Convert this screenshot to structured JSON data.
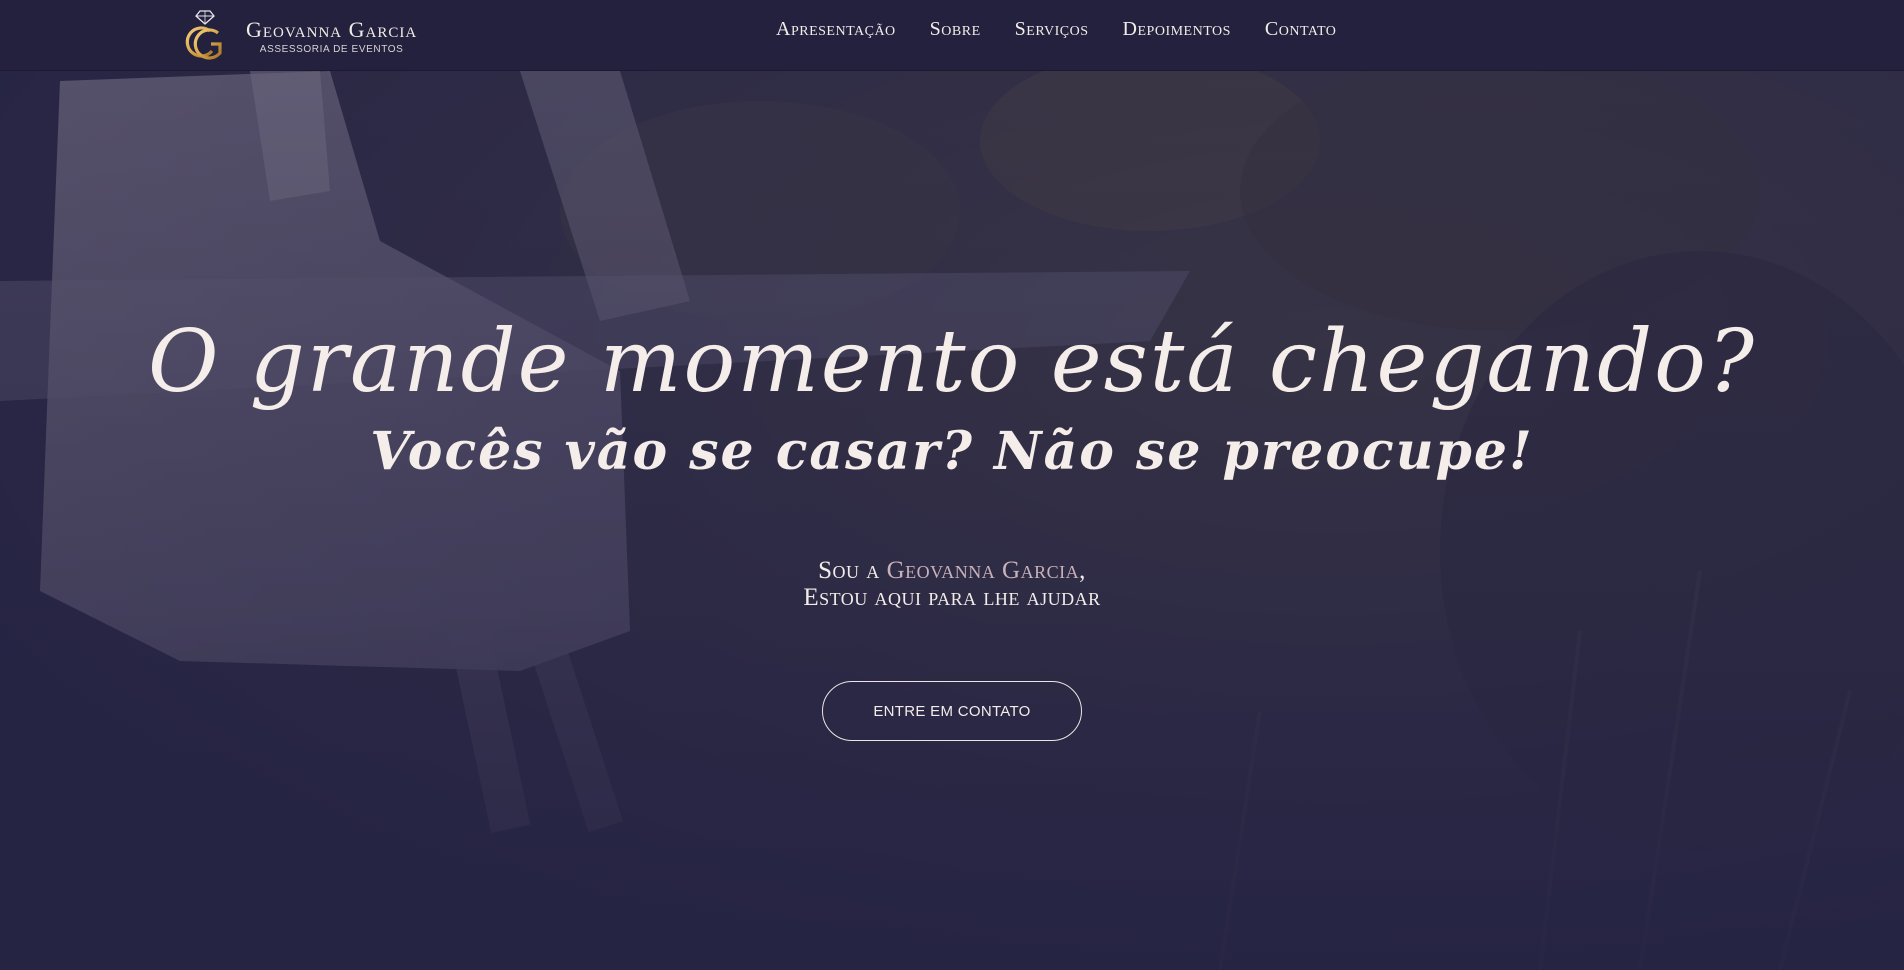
{
  "header": {
    "brand_name": "Geovanna Garcia",
    "brand_tagline": "ASSESSORIA DE EVENTOS",
    "nav": [
      {
        "label": "Apresentação"
      },
      {
        "label": "Sobre"
      },
      {
        "label": "Serviços"
      },
      {
        "label": "Depoimentos"
      },
      {
        "label": "Contato"
      }
    ]
  },
  "hero": {
    "headline": "O grande momento está chegando?",
    "subheadline": "Vocês vão se casar? Não se preocupe!",
    "intro_prefix": "Sou a ",
    "intro_name": "Geovanna Garcia",
    "intro_suffix": ",",
    "intro_line2": "Estou aqui para lhe ajudar",
    "cta_label": "ENTRE EM CONTATO",
    "background_image": "couple-wedding-photo"
  },
  "colors": {
    "header_bg": "#23213d",
    "overlay": "#262443",
    "text": "#f3ece8",
    "accent_name": "#c9b1b9",
    "logo_gold": "#d9a64a"
  }
}
